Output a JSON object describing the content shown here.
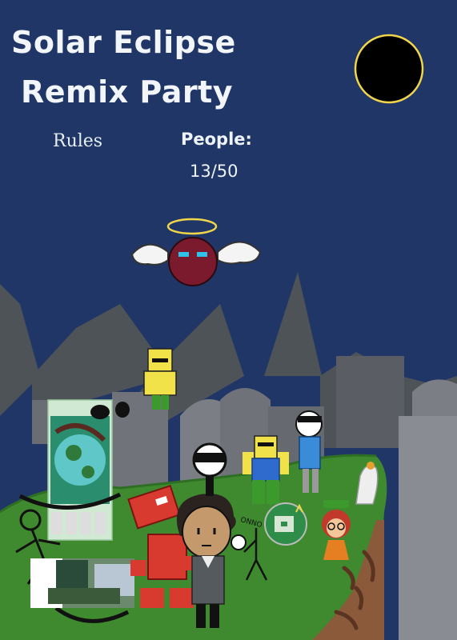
{
  "header": {
    "title_line1": "Solar Eclipse",
    "title_line2": "Remix Party"
  },
  "nav": {
    "rules_label": "Rules"
  },
  "stats": {
    "people_label": "People:",
    "people_count": "13/50"
  },
  "scene": {
    "sky_color": "#1f3667",
    "eclipse_ring_color": "#f1d64a",
    "hill_color": "#3f8a2e"
  }
}
